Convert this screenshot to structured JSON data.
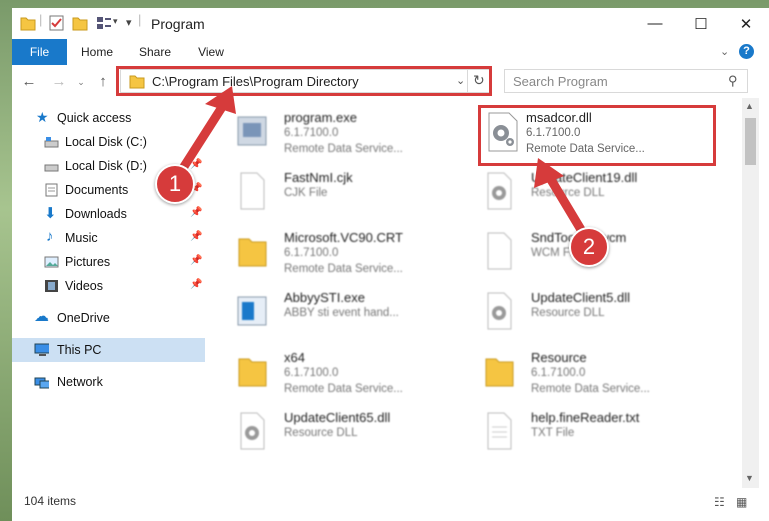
{
  "window": {
    "title": "Program"
  },
  "ribbon": {
    "tabs": [
      "File",
      "Home",
      "Share",
      "View"
    ]
  },
  "address": {
    "path": "C:\\Program Files\\Program Directory"
  },
  "search": {
    "placeholder": "Search Program"
  },
  "nav": {
    "quick_access": "Quick access",
    "items": [
      {
        "label": "Local Disk (C:)",
        "icon": "drive-icon",
        "pinned": false
      },
      {
        "label": "Local Disk (D:)",
        "icon": "drive-icon",
        "pinned": true
      },
      {
        "label": "Documents",
        "icon": "documents-icon",
        "pinned": true
      },
      {
        "label": "Downloads",
        "icon": "download-icon",
        "pinned": true
      },
      {
        "label": "Music",
        "icon": "music-icon",
        "pinned": true
      },
      {
        "label": "Pictures",
        "icon": "pictures-icon",
        "pinned": true
      },
      {
        "label": "Videos",
        "icon": "videos-icon",
        "pinned": true
      }
    ],
    "onedrive": "OneDrive",
    "this_pc": "This PC",
    "network": "Network"
  },
  "files": [
    {
      "name": "program.exe",
      "line2": "6.1.7100.0",
      "line3": "Remote Data Service...",
      "icon": "exe-icon"
    },
    {
      "name": "msadcor.dll",
      "line2": "6.1.7100.0",
      "line3": "Remote Data Service...",
      "icon": "dll-gear-icon"
    },
    {
      "name": "FastNmI.cjk",
      "line2": "CJK File",
      "line3": "",
      "icon": "blank-file-icon"
    },
    {
      "name": "UpdateClient19.dll",
      "line2": "Resource DLL",
      "line3": "",
      "icon": "dll-gear-icon"
    },
    {
      "name": "Microsoft.VC90.CRT",
      "line2": "6.1.7100.0",
      "line3": "Remote Data Service...",
      "icon": "folder-icon"
    },
    {
      "name": "SndToolbar.wcm",
      "line2": "WCM File",
      "line3": "",
      "icon": "blank-file-icon"
    },
    {
      "name": "AbbyySTI.exe",
      "line2": "ABBY sti event hand...",
      "line3": "",
      "icon": "exe-blue-icon"
    },
    {
      "name": "UpdateClient5.dll",
      "line2": "Resource DLL",
      "line3": "",
      "icon": "dll-gear-icon"
    },
    {
      "name": "x64",
      "line2": "6.1.7100.0",
      "line3": "Remote Data Service...",
      "icon": "folder-icon"
    },
    {
      "name": "Resource",
      "line2": "6.1.7100.0",
      "line3": "Remote Data Service...",
      "icon": "folder-icon"
    },
    {
      "name": "UpdateClient65.dll",
      "line2": "Resource DLL",
      "line3": "",
      "icon": "dll-gear-icon"
    },
    {
      "name": "help.fineReader.txt",
      "line2": "TXT File",
      "line3": "",
      "icon": "text-file-icon"
    }
  ],
  "status": {
    "count": "104 items"
  },
  "annotations": {
    "badge1": "1",
    "badge2": "2",
    "color": "#d63b3b"
  }
}
